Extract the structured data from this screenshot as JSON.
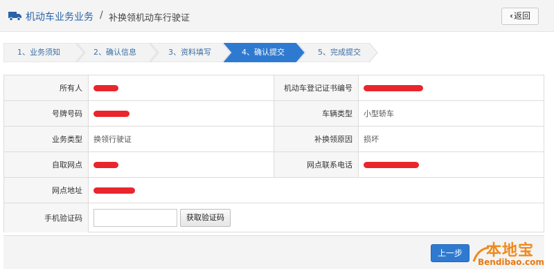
{
  "header": {
    "breadcrumb_main": "机动车业务业务",
    "breadcrumb_sep": "/",
    "breadcrumb_current": "补换领机动车行驶证",
    "back_label": "返回"
  },
  "steps": [
    {
      "label": "1、业务须知",
      "active": false
    },
    {
      "label": "2、确认信息",
      "active": false
    },
    {
      "label": "3、资料填写",
      "active": false
    },
    {
      "label": "4、确认提交",
      "active": true
    },
    {
      "label": "5、完成提交",
      "active": false
    }
  ],
  "form": {
    "owner_label": "所有人",
    "owner_value": "",
    "cert_label": "机动车登记证书编号",
    "cert_value": "",
    "plate_label": "号牌号码",
    "plate_value": "",
    "vehicle_type_label": "车辆类型",
    "vehicle_type_value": "小型轿车",
    "biz_type_label": "业务类型",
    "biz_type_value": "换领行驶证",
    "reason_label": "补换领原因",
    "reason_value": "损坏",
    "pickup_label": "自取网点",
    "pickup_value": "",
    "phone_label": "网点联系电话",
    "phone_value": "",
    "address_label": "网点地址",
    "address_value": "",
    "sms_label": "手机验证码",
    "sms_placeholder": "",
    "get_code_label": "获取验证码"
  },
  "footer": {
    "prev_label": "上一步"
  },
  "watermark": {
    "logo_text": "本地宝",
    "url_text": "Bendibao.com"
  },
  "colors": {
    "accent": "#2f7ad1",
    "step_active": "#2f7ad1",
    "redaction": "#e8262c"
  },
  "icons": {
    "truck": "truck-icon",
    "back": "chevron-left-icon"
  }
}
